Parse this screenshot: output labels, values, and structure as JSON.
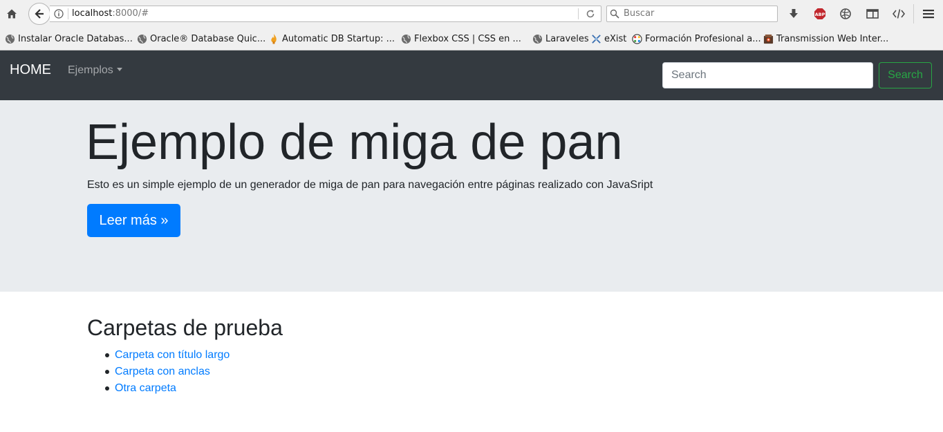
{
  "browser": {
    "url_host": "localhost",
    "url_rest": ":8000/#",
    "search_placeholder": "Buscar",
    "bookmarks": [
      {
        "label": "Instalar Oracle Databas...",
        "icon": "globe-icon"
      },
      {
        "label": "Oracle® Database Quic...",
        "icon": "globe-icon"
      },
      {
        "label": "Automatic DB Startup: ...",
        "icon": "flame-icon"
      },
      {
        "label": "Flexbox CSS | CSS en ...",
        "icon": "globe-icon"
      },
      {
        "label": "Laraveles",
        "icon": "globe-icon"
      },
      {
        "label": "eXist",
        "icon": "exist-icon"
      },
      {
        "label": "Formación Profesional a...",
        "icon": "dots-icon"
      },
      {
        "label": "Transmission Web Inter...",
        "icon": "transmission-icon"
      }
    ],
    "adblock_label": "ABP"
  },
  "navbar": {
    "brand": "HOME",
    "dropdown": "Ejemplos",
    "search_placeholder": "Search",
    "search_button": "Search"
  },
  "jumbotron": {
    "title": "Ejemplo de miga de pan",
    "lead": "Esto es un simple ejemplo de un generador de miga de pan para navegación entre páginas realizado con JavaSript",
    "button": "Leer más »"
  },
  "folders": {
    "heading": "Carpetas de prueba",
    "items": [
      "Carpeta con título largo",
      "Carpeta con anclas",
      "Otra carpeta"
    ]
  },
  "colors": {
    "navbar_bg": "#343a40",
    "jumbotron_bg": "#e9ecef",
    "primary": "#007bff",
    "success": "#28a745"
  }
}
